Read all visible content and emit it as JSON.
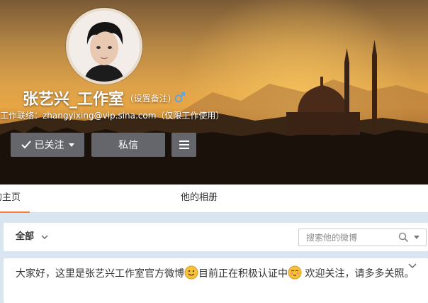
{
  "profile": {
    "name": "张艺兴_工作室",
    "remark_label": "(设置备注)",
    "gender_icon": "male-icon",
    "contact": "工作联络：zhangyixing@vip.sina.com（仅限工作使用）"
  },
  "actions": {
    "follow_label": "已关注",
    "message_label": "私信",
    "more_icon": "menu-icon"
  },
  "tabs": [
    {
      "label": "的主页",
      "active": true
    },
    {
      "label": "他的相册",
      "active": false
    }
  ],
  "filter": {
    "all_label": "全部",
    "search_placeholder": "搜索他的微博"
  },
  "post": {
    "part1": "大家好，这里是张艺兴工作室官方微博",
    "part2": "目前正在积极认证中",
    "part3": " 欢迎关注，请多多关照。"
  },
  "colors": {
    "accent": "#fa7d3c",
    "button_bg": "#6b6d75",
    "page_bg": "#d9e6f2",
    "gender": "#5ea3e8"
  }
}
